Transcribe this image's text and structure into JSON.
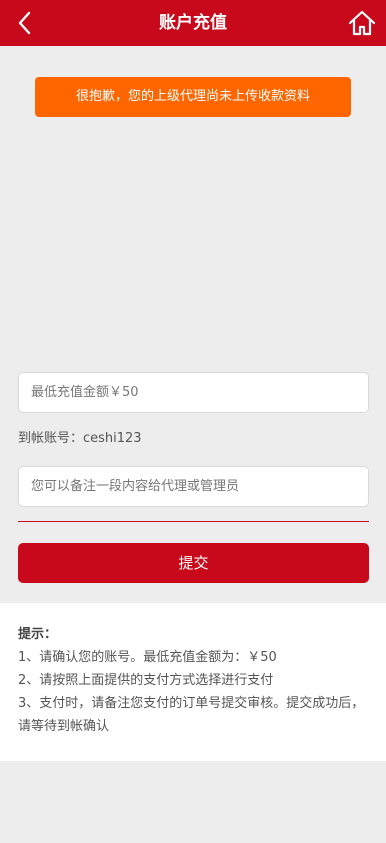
{
  "header": {
    "title": "账户充值"
  },
  "notice": {
    "text": "很抱歉，您的上级代理尚未上传收款资料"
  },
  "form": {
    "amount_placeholder": "最低充值金额￥50",
    "account_text": "到帐账号：ceshi123",
    "remark_placeholder": "您可以备注一段内容给代理或管理员",
    "submit_label": "提交"
  },
  "tips": {
    "title": "提示：",
    "lines": [
      "1、请确认您的账号。最低充值金额为：￥50",
      "2、请按照上面提供的支付方式选择进行支付",
      "3、支付时，请备注您支付的订单号提交审核。提交成功后，请等待到帐确认"
    ]
  },
  "colors": {
    "brand_red": "#c8091b",
    "notice_orange": "#ff6600",
    "background": "#ededed"
  },
  "icons": {
    "back": "chevron-left-icon",
    "home": "home-icon"
  }
}
